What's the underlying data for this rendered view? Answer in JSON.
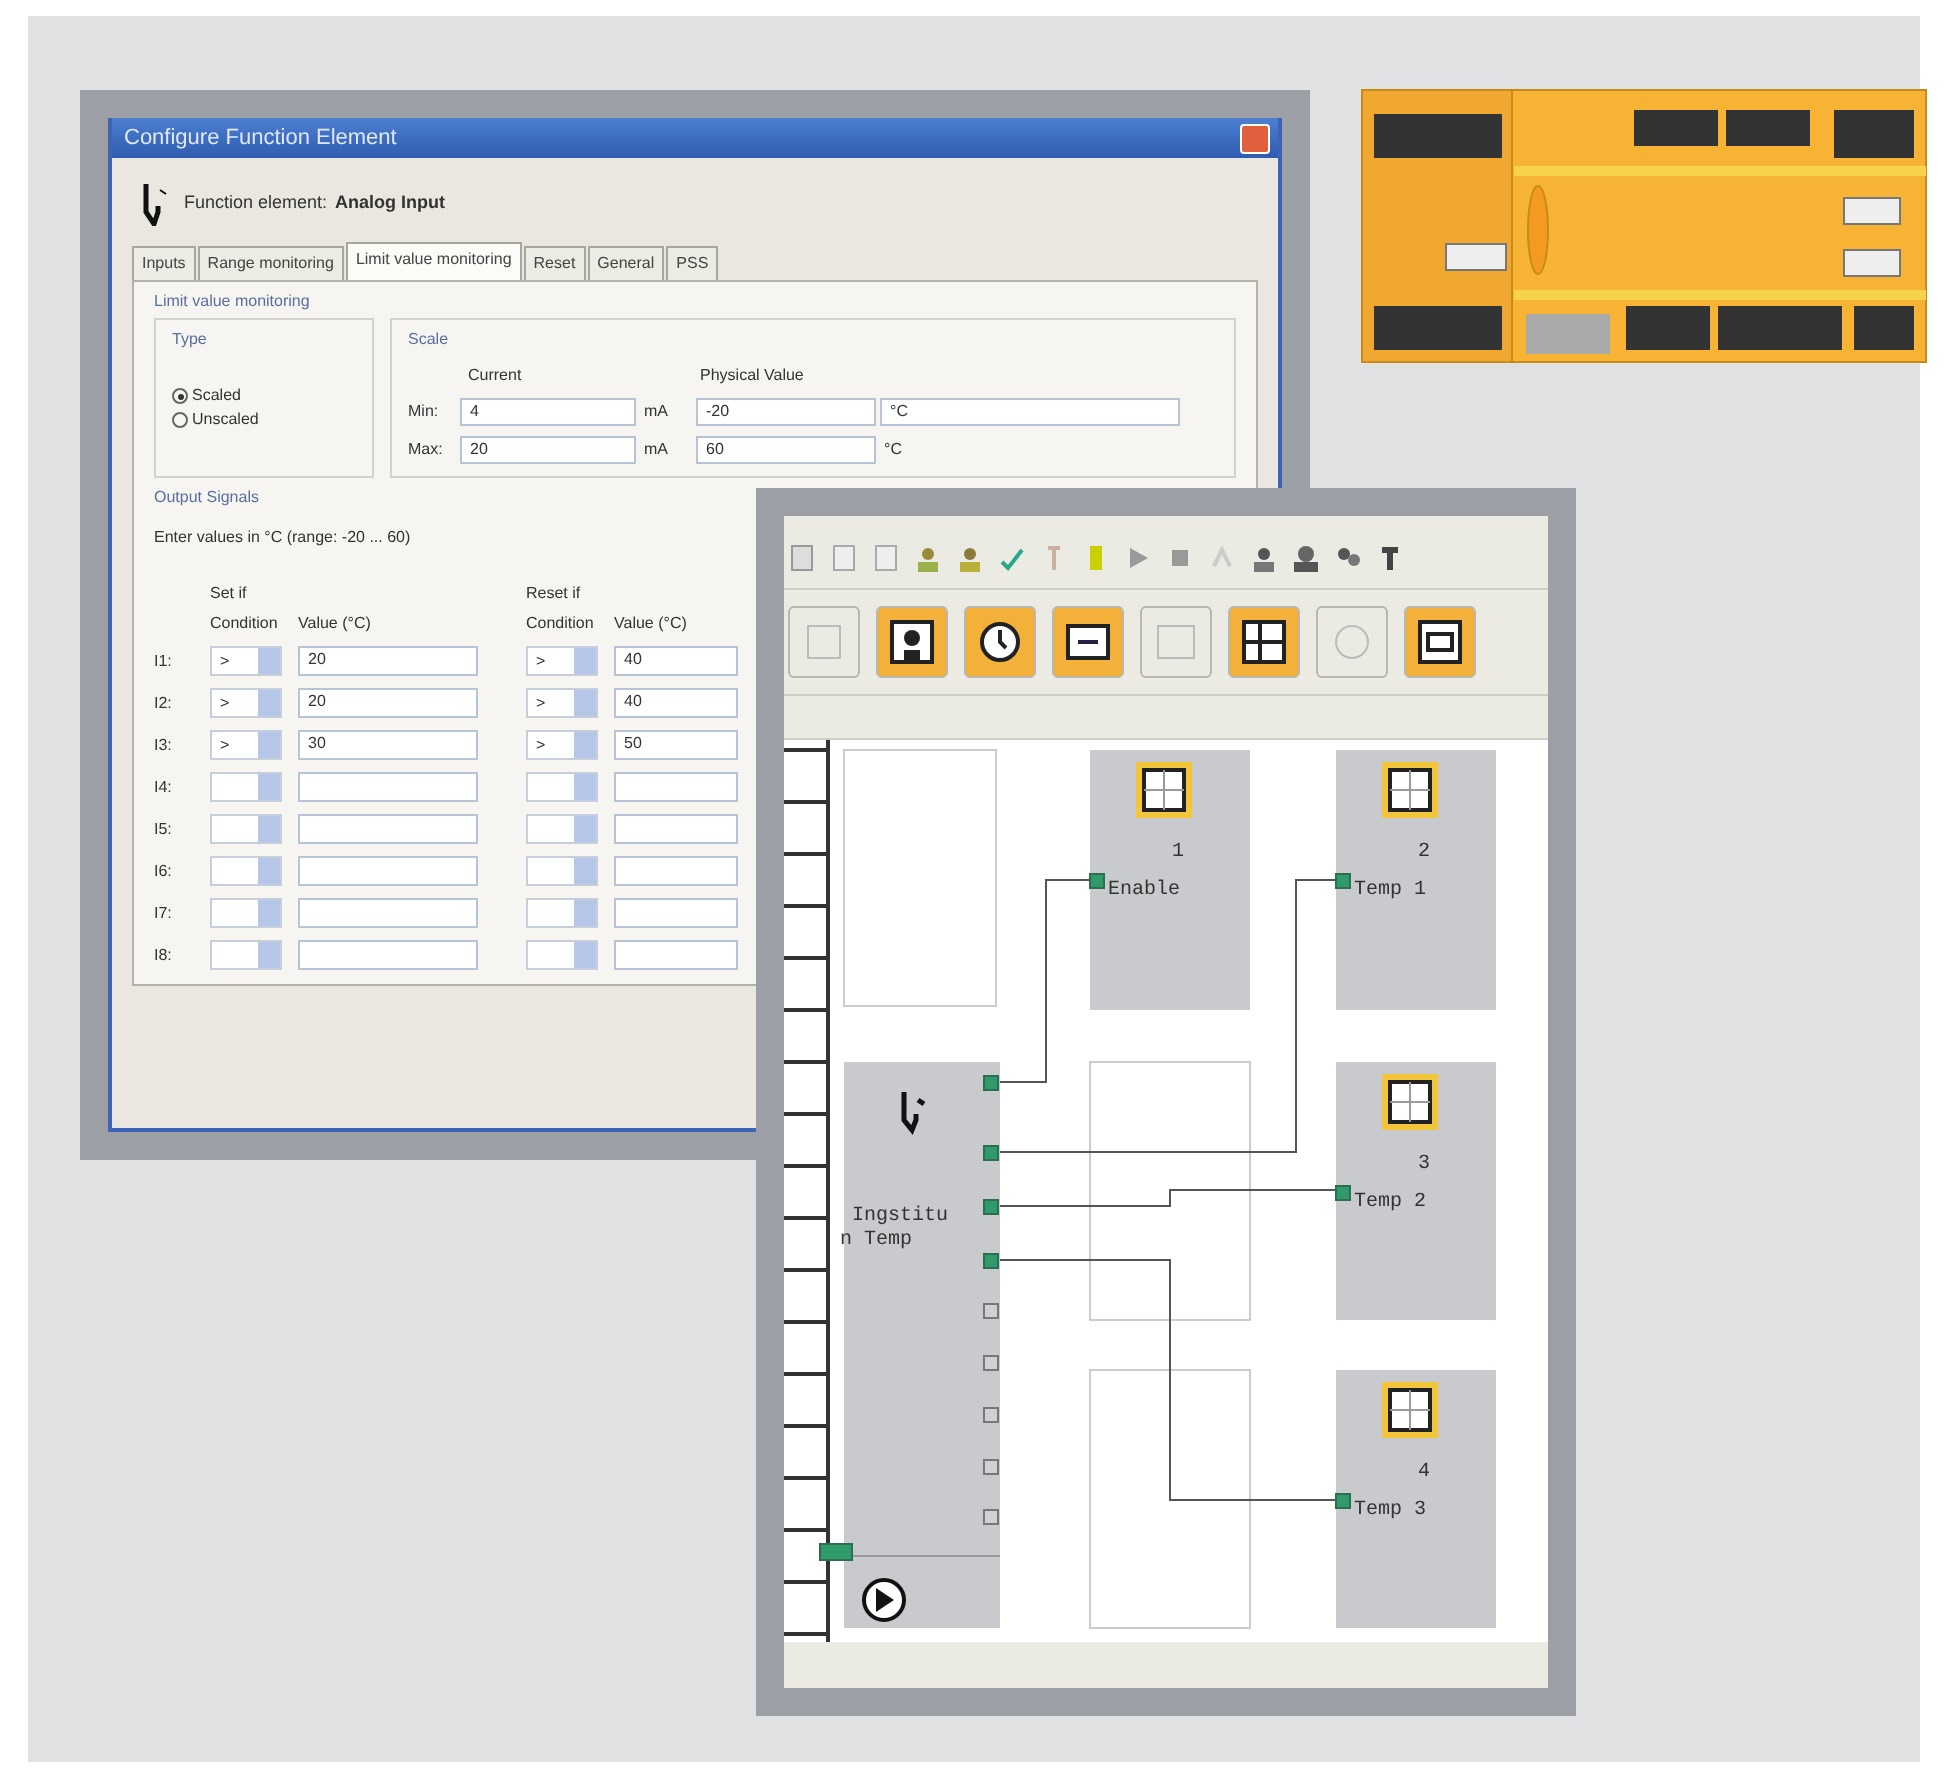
{
  "dialog": {
    "title": "Configure Function Element",
    "element_label": "Function element:",
    "element_name": "Analog Input",
    "tabs": [
      {
        "label": "Inputs",
        "selected": false
      },
      {
        "label": "Range monitoring",
        "selected": false
      },
      {
        "label": "Limit value monitoring",
        "selected": true
      },
      {
        "label": "Reset",
        "selected": false
      },
      {
        "label": "General",
        "selected": false
      },
      {
        "label": "PSS",
        "selected": false
      }
    ],
    "group_title": "Limit value monitoring",
    "type": {
      "title": "Type",
      "options": [
        {
          "label": "Scaled",
          "selected": true
        },
        {
          "label": "Unscaled",
          "selected": false
        }
      ]
    },
    "scale": {
      "title": "Scale",
      "current_header": "Current",
      "physical_header": "Physical Value",
      "rows": [
        {
          "label": "Min:",
          "current": "4",
          "current_unit": "mA",
          "physical": "-20",
          "physical_unit": "°C",
          "unit_boxed": true
        },
        {
          "label": "Max:",
          "current": "20",
          "current_unit": "mA",
          "physical": "60",
          "physical_unit": "°C",
          "unit_boxed": false
        }
      ]
    },
    "output": {
      "title": "Output Signals",
      "hint": "Enter values in °C (range: -20 ... 60)",
      "set_title": "Set if",
      "reset_title": "Reset if",
      "set_condition_header": "Condition",
      "set_value_header": "Value (°C)",
      "reset_condition_header": "Condition",
      "reset_value_header": "Value (°C)",
      "rows": [
        {
          "label": "I1:",
          "set_condition": ">",
          "set_value": "20",
          "reset_condition": ">",
          "reset_value": "40"
        },
        {
          "label": "I2:",
          "set_condition": ">",
          "set_value": "20",
          "reset_condition": ">",
          "reset_value": "40"
        },
        {
          "label": "I3:",
          "set_condition": ">",
          "set_value": "30",
          "reset_condition": ">",
          "reset_value": "50"
        },
        {
          "label": "I4:"
        },
        {
          "label": "I5:"
        },
        {
          "label": "I6:"
        },
        {
          "label": "I7:"
        },
        {
          "label": "I8:"
        }
      ]
    }
  },
  "editor": {
    "input_block": {
      "lines": [
        "Ingstitu",
        "n Temp"
      ]
    },
    "output_blocks": [
      {
        "number": "1",
        "label": "Enable"
      },
      {
        "number": "2",
        "label": "Temp 1"
      },
      {
        "number": "3",
        "label": "Temp 2"
      },
      {
        "number": "4",
        "label": "Temp 3"
      }
    ]
  }
}
